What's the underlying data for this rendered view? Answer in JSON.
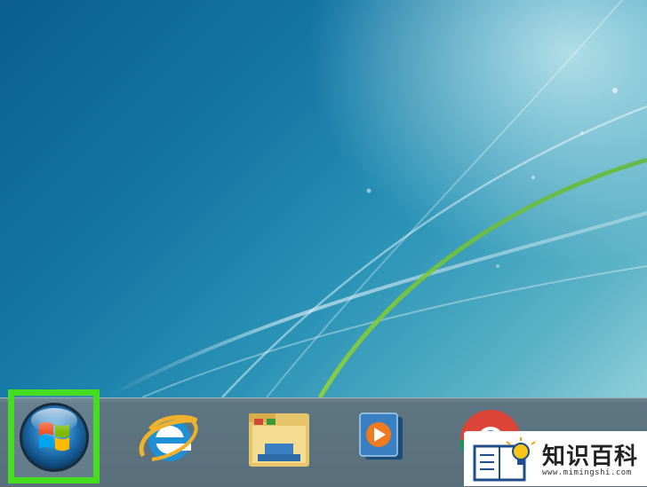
{
  "screen": {
    "desktop": {
      "wallpaper": "windows-7-default-teal"
    },
    "taskbar": {
      "start_button": {
        "icon": "windows-7-start-orb",
        "highlighted": true,
        "highlight_color": "#45dd1f"
      },
      "pinned": [
        {
          "name": "Internet Explorer",
          "icon": "internet-explorer-icon"
        },
        {
          "name": "Windows Explorer",
          "icon": "folder-explorer-icon"
        },
        {
          "name": "Windows Media Player",
          "icon": "media-player-icon"
        },
        {
          "name": "Google Chrome",
          "icon": "chrome-icon"
        }
      ]
    },
    "watermark": {
      "title": "知识百科",
      "url": "www.mimingshi.com"
    }
  }
}
